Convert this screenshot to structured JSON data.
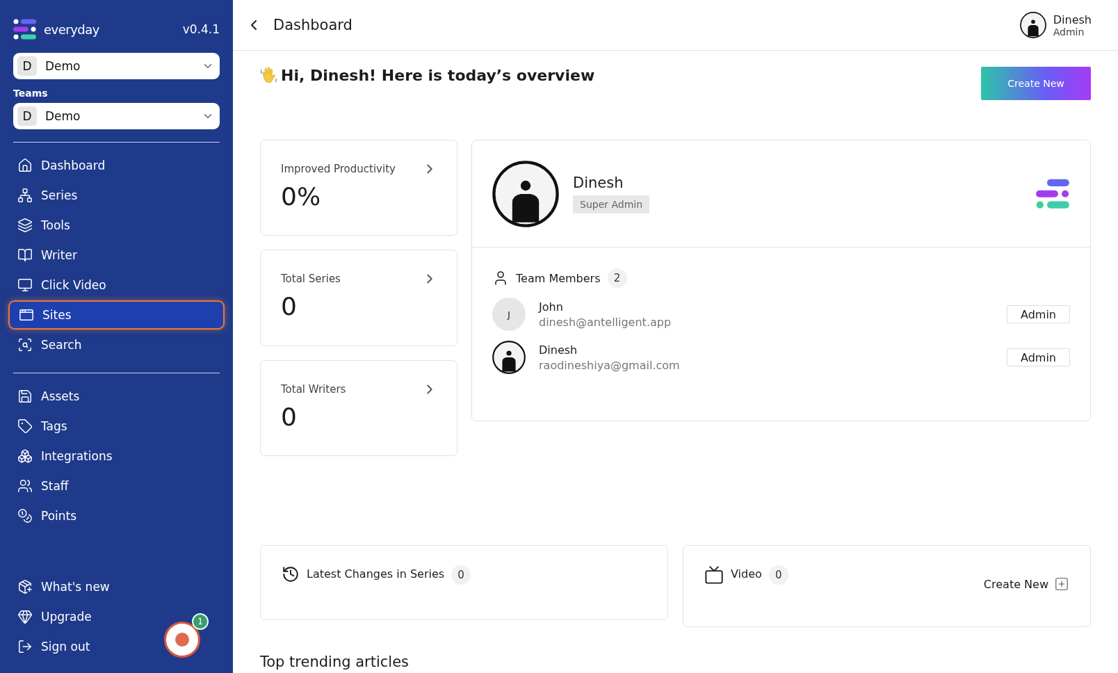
{
  "sidebar": {
    "brand": "everyday",
    "version": "v0.4.1",
    "workspace": {
      "initial": "D",
      "name": "Demo"
    },
    "teams_label": "Teams",
    "team": {
      "initial": "D",
      "name": "Demo"
    },
    "nav": [
      {
        "label": "Dashboard",
        "selected": false
      },
      {
        "label": "Series",
        "selected": false
      },
      {
        "label": "Tools",
        "selected": false
      },
      {
        "label": "Writer",
        "selected": false
      },
      {
        "label": "Click Video",
        "selected": false
      },
      {
        "label": "Sites",
        "selected": true
      },
      {
        "label": "Search",
        "selected": false
      }
    ],
    "nav_secondary": [
      {
        "label": "Assets",
        "selected": false
      },
      {
        "label": "Tags",
        "selected": false
      },
      {
        "label": "Integrations",
        "selected": false
      },
      {
        "label": "Staff",
        "selected": false
      },
      {
        "label": "Points",
        "selected": false
      }
    ],
    "footer": [
      {
        "label": "What's new"
      },
      {
        "label": "Upgrade"
      },
      {
        "label": "Sign out"
      }
    ]
  },
  "record_button": {
    "badge": "1"
  },
  "header": {
    "title": "Dashboard",
    "user": {
      "name": "Dinesh",
      "role": "Admin"
    }
  },
  "greeting": "Hi, Dinesh! Here is today’s overview",
  "create_button": "Create New",
  "stats": [
    {
      "label": "Improved Productivity",
      "value": "0%"
    },
    {
      "label": "Total Series",
      "value": "0"
    },
    {
      "label": "Total Writers",
      "value": "0"
    }
  ],
  "profile": {
    "name": "Dinesh",
    "role": "Super Admin"
  },
  "team": {
    "title": "Team Members",
    "count": "2",
    "members": [
      {
        "name": "John",
        "email": "dinesh@antelligent.app",
        "role": "Admin",
        "initial": "J"
      },
      {
        "name": "Dinesh",
        "email": "raodineshiya@gmail.com",
        "role": "Admin"
      }
    ]
  },
  "latest": {
    "title": "Latest Changes in Series",
    "count": "0"
  },
  "video": {
    "title": "Video",
    "count": "0",
    "action": "Create New"
  },
  "trending": {
    "title": "Top trending articles"
  }
}
